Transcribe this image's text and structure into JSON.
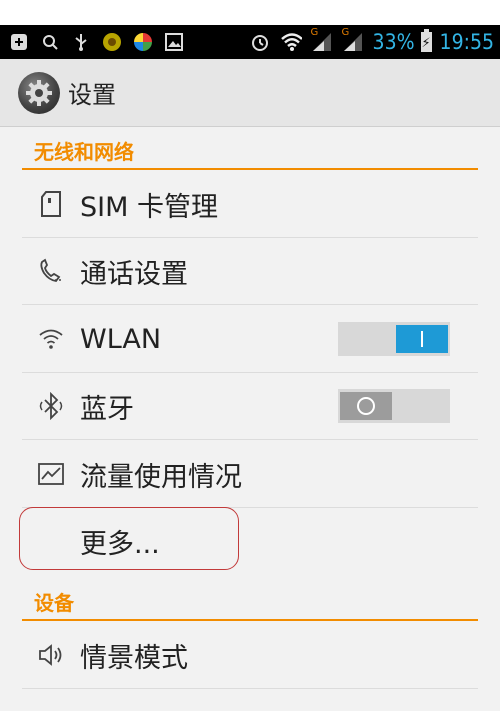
{
  "status_bar": {
    "battery_percent": "33%",
    "time": "19:55",
    "signal_label_1": "G",
    "signal_label_2": "G",
    "icons": [
      "add-box-icon",
      "search-icon",
      "usb-icon",
      "app-badge-icon",
      "app-swirl-icon",
      "image-icon",
      "alarm-icon",
      "wifi-icon",
      "signal-icon",
      "signal-icon",
      "battery-charging-icon"
    ]
  },
  "action_bar": {
    "title": "设置",
    "icon": "gear-icon"
  },
  "sections": [
    {
      "header": "无线和网络",
      "items": [
        {
          "label": "SIM 卡管理",
          "icon": "sim-card-icon"
        },
        {
          "label": "通话设置",
          "icon": "phone-icon"
        },
        {
          "label": "WLAN",
          "icon": "wifi-icon",
          "toggle": "on"
        },
        {
          "label": "蓝牙",
          "icon": "bluetooth-icon",
          "toggle": "off"
        },
        {
          "label": "流量使用情况",
          "icon": "data-usage-icon"
        },
        {
          "label": "更多...",
          "icon": ""
        }
      ]
    },
    {
      "header": "设备",
      "items": [
        {
          "label": "情景模式",
          "icon": "volume-icon"
        }
      ]
    }
  ],
  "colors": {
    "accent": "#f28c00",
    "switch_on": "#1e9ad6",
    "status_text": "#33b5e5",
    "highlight_box": "#c23a3a"
  }
}
